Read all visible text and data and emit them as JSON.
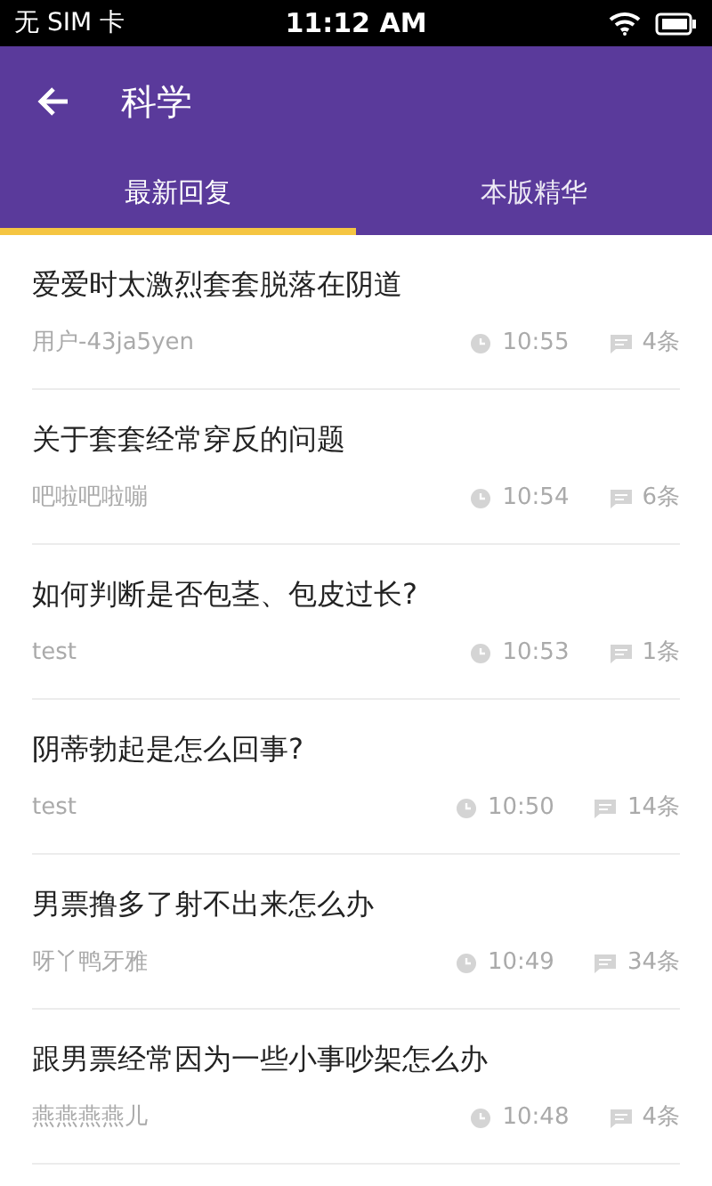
{
  "status_bar": {
    "carrier": "无 SIM 卡",
    "time": "11:12 AM"
  },
  "header": {
    "title": "科学"
  },
  "tabs": [
    {
      "label": "最新回复",
      "selected": true
    },
    {
      "label": "本版精华",
      "selected": false
    }
  ],
  "posts": [
    {
      "title": "爱爱时太激烈套套脱落在阴道",
      "author": "用户-43ja5yen",
      "time": "10:55",
      "replies": "4条"
    },
    {
      "title": "关于套套经常穿反的问题",
      "author": "吧啦吧啦嘣",
      "time": "10:54",
      "replies": "6条"
    },
    {
      "title": "如何判断是否包茎、包皮过长?",
      "author": "test",
      "time": "10:53",
      "replies": "1条"
    },
    {
      "title": "阴蒂勃起是怎么回事?",
      "author": "test",
      "time": "10:50",
      "replies": "14条"
    },
    {
      "title": "男票撸多了射不出来怎么办",
      "author": "呀丫鸭牙雅",
      "time": "10:49",
      "replies": "34条"
    },
    {
      "title": "跟男票经常因为一些小事吵架怎么办",
      "author": "燕燕燕燕儿",
      "time": "10:48",
      "replies": "4条"
    }
  ]
}
